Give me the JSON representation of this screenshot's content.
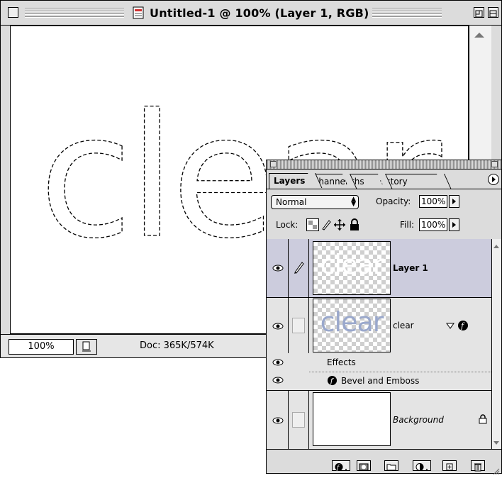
{
  "document_window": {
    "title": "Untitled-1 @ 100% (Layer 1, RGB)",
    "canvas_text": "clear",
    "zoom": "100%",
    "doc_size": "Doc: 365K/574K"
  },
  "layers_palette": {
    "tabs": [
      {
        "label": "Layers",
        "active": true
      },
      {
        "label": "Channels",
        "active": false
      },
      {
        "label": "Paths",
        "active": false
      },
      {
        "label": "History",
        "active": false
      }
    ],
    "blend_mode": "Normal",
    "opacity_label": "Opacity:",
    "opacity_value": "100%",
    "lock_label": "Lock:",
    "fill_label": "Fill:",
    "fill_value": "100%",
    "layers": [
      {
        "name": "Layer 1",
        "thumbnail_text": "clear",
        "selected": true,
        "visible": true
      },
      {
        "name": "clear",
        "thumbnail_text": "clear",
        "selected": false,
        "visible": true,
        "has_effects": true
      },
      {
        "name": "Background",
        "selected": false,
        "visible": true,
        "locked": true
      }
    ],
    "effects_label": "Effects",
    "effect_item": "Bevel and Emboss"
  },
  "colors": {
    "window_bg": "#dcdcdc",
    "selected_layer": "#ccccdd",
    "clear_text_blue": "#9aa8cc"
  }
}
